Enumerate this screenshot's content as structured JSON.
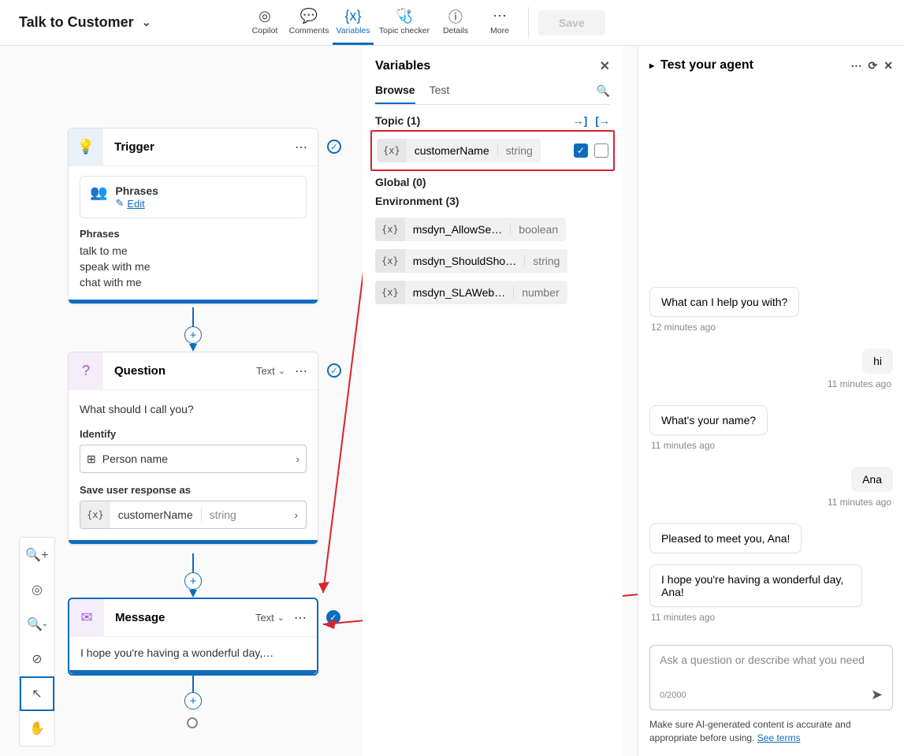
{
  "title": "Talk to Customer",
  "toolbar": {
    "tabs": [
      {
        "label": "Copilot"
      },
      {
        "label": "Comments"
      },
      {
        "label": "Variables"
      },
      {
        "label": "Topic checker"
      },
      {
        "label": "Details"
      },
      {
        "label": "More"
      }
    ],
    "save_label": "Save"
  },
  "vars": {
    "panel_title": "Variables",
    "tabs": {
      "browse": "Browse",
      "test": "Test"
    },
    "groups": {
      "topic": "Topic (1)",
      "global": "Global (0)",
      "env": "Environment (3)"
    },
    "topic_var": {
      "name": "customerName",
      "type": "string"
    },
    "env_vars": [
      {
        "name": "msdyn_AllowSe…",
        "type": "boolean"
      },
      {
        "name": "msdyn_ShouldSho…",
        "type": "string"
      },
      {
        "name": "msdyn_SLAWeb…",
        "type": "number"
      }
    ]
  },
  "nodes": {
    "trigger": {
      "title": "Trigger",
      "phrases_label": "Phrases",
      "edit": "Edit",
      "phrases_header": "Phrases",
      "phrases": [
        "talk to me",
        "speak with me",
        "chat with me"
      ]
    },
    "question": {
      "title": "Question",
      "type": "Text",
      "prompt": "What should I call you?",
      "identify_label": "Identify",
      "identify_value": "Person name",
      "save_as_label": "Save user response as",
      "var_name": "customerName",
      "var_type": "string"
    },
    "message": {
      "title": "Message",
      "type": "Text",
      "body": "I hope you're having a wonderful day,…"
    }
  },
  "test": {
    "title": "Test your agent",
    "msgs": [
      {
        "role": "bot",
        "text": "What can I help you with?",
        "ts": "12 minutes ago"
      },
      {
        "role": "user",
        "text": "hi",
        "ts": "11 minutes ago"
      },
      {
        "role": "bot",
        "text": "What's your name?",
        "ts": "11 minutes ago"
      },
      {
        "role": "user",
        "text": "Ana",
        "ts": "11 minutes ago"
      },
      {
        "role": "bot",
        "text": "Pleased to meet you, Ana!",
        "ts": ""
      },
      {
        "role": "bot",
        "text": "I hope you're having a wonderful day, Ana!",
        "ts": "11 minutes ago"
      }
    ],
    "placeholder": "Ask a question or describe what you need",
    "counter": "0/2000",
    "disclaimer": "Make sure AI-generated content is accurate and appropriate before using. ",
    "see_terms": "See terms"
  }
}
